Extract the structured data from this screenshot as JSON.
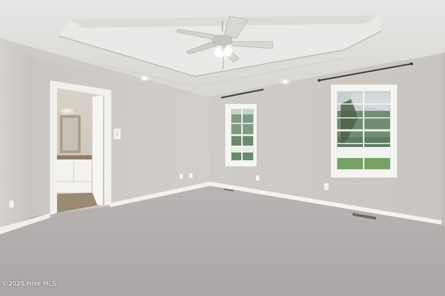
{
  "photo": {
    "watermark": "©2025 Hive MLS"
  }
}
